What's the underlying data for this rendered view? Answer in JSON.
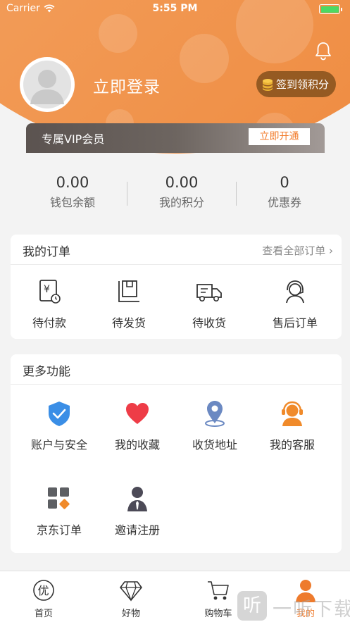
{
  "status_bar": {
    "carrier": "Carrier",
    "time": "5:55 PM"
  },
  "header": {
    "login_text": "立即登录",
    "signin_button": "签到领积分",
    "vip_label": "专属VIP会员",
    "vip_button": "立即开通"
  },
  "stats": [
    {
      "value": "0.00",
      "label": "钱包余额"
    },
    {
      "value": "0.00",
      "label": "我的积分"
    },
    {
      "value": "0",
      "label": "优惠券"
    }
  ],
  "orders": {
    "title": "我的订单",
    "view_all": "查看全部订单 ›",
    "items": [
      {
        "label": "待付款",
        "icon": "payment-icon"
      },
      {
        "label": "待发货",
        "icon": "package-icon"
      },
      {
        "label": "待收货",
        "icon": "truck-icon"
      },
      {
        "label": "售后订单",
        "icon": "service-agent-icon"
      }
    ]
  },
  "more": {
    "title": "更多功能",
    "items": [
      {
        "label": "账户与安全",
        "icon": "shield-check-icon"
      },
      {
        "label": "我的收藏",
        "icon": "heart-icon"
      },
      {
        "label": "收货地址",
        "icon": "location-pin-icon"
      },
      {
        "label": "我的客服",
        "icon": "headset-icon"
      },
      {
        "label": "京东订单",
        "icon": "grid-icon"
      },
      {
        "label": "邀请注册",
        "icon": "person-tie-icon"
      }
    ]
  },
  "tabbar": {
    "active": "我的",
    "items": [
      {
        "label": "首页",
        "icon": "you-badge-icon"
      },
      {
        "label": "好物",
        "icon": "diamond-icon"
      },
      {
        "label": "购物车",
        "icon": "cart-icon"
      },
      {
        "label": "我的",
        "icon": "user-icon"
      }
    ]
  },
  "watermark": {
    "glyph": "听",
    "text": "一听下载"
  },
  "colors": {
    "accent": "#ee7b2d",
    "header_light": "#f7a15f",
    "vip_button_text": "#f27c2c",
    "signin_bg": "#955a22"
  }
}
